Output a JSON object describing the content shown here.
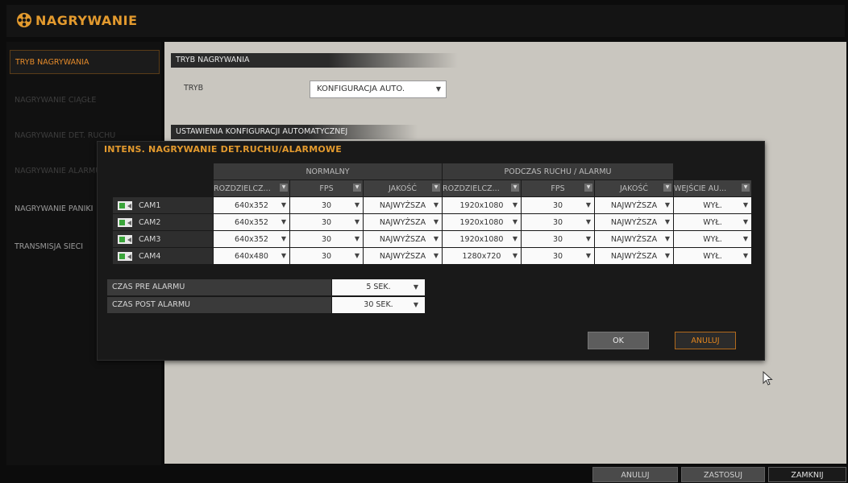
{
  "app": {
    "title": "NAGRYWANIE",
    "icon": "film-reel-icon"
  },
  "sidebar": {
    "items": [
      {
        "label": "TRYB NAGRYWANIA",
        "active": true
      },
      {
        "label": "NAGRYWANIE CIĄGŁE",
        "dim": true
      },
      {
        "label": "NAGRYWANIE DET. RUCHU",
        "dim": true
      },
      {
        "label": "NAGRYWANIE ALARMU",
        "dim": true
      },
      {
        "label": "NAGRYWANIE PANIKI"
      },
      {
        "label": "TRANSMISJA SIECI"
      }
    ]
  },
  "main": {
    "section_mode": "TRYB NAGRYWANIA",
    "mode_label": "TRYB",
    "mode_value": "KONFIGURACJA AUTO.",
    "section_auto": "USTAWIENIA KONFIGURACJI AUTOMATYCZNEJ"
  },
  "dialog": {
    "title": "INTENS. NAGRYWANIE DET.RUCHU/ALARMOWE",
    "group_normal": "NORMALNY",
    "group_event": "PODCZAS RUCHU / ALARMU",
    "columns": [
      "ROZDZIELCZ...",
      "FPS",
      "JAKOŚĆ",
      "ROZDZIELCZ...",
      "FPS",
      "JAKOŚĆ",
      "WEJŚCIE AU..."
    ],
    "rows": [
      {
        "cam": "CAM1",
        "cells": [
          "640x352",
          "30",
          "NAJWYŻSZA",
          "1920x1080",
          "30",
          "NAJWYŻSZA",
          "WYŁ."
        ]
      },
      {
        "cam": "CAM2",
        "cells": [
          "640x352",
          "30",
          "NAJWYŻSZA",
          "1920x1080",
          "30",
          "NAJWYŻSZA",
          "WYŁ."
        ]
      },
      {
        "cam": "CAM3",
        "cells": [
          "640x352",
          "30",
          "NAJWYŻSZA",
          "1920x1080",
          "30",
          "NAJWYŻSZA",
          "WYŁ."
        ]
      },
      {
        "cam": "CAM4",
        "cells": [
          "640x480",
          "30",
          "NAJWYŻSZA",
          "1280x720",
          "30",
          "NAJWYŻSZA",
          "WYŁ."
        ]
      }
    ],
    "pre_alarm_label": "CZAS PRE ALARMU",
    "pre_alarm_value": "5 SEK.",
    "post_alarm_label": "CZAS POST ALARMU",
    "post_alarm_value": "30 SEK.",
    "ok": "OK",
    "cancel": "ANULUJ"
  },
  "footer": {
    "cancel": "ANULUJ",
    "apply": "ZASTOSUJ",
    "close": "ZAMKNIJ"
  },
  "colors": {
    "accent": "#e39a2e",
    "content_bg": "#c9c6bf",
    "dialog_bg": "#191919"
  }
}
